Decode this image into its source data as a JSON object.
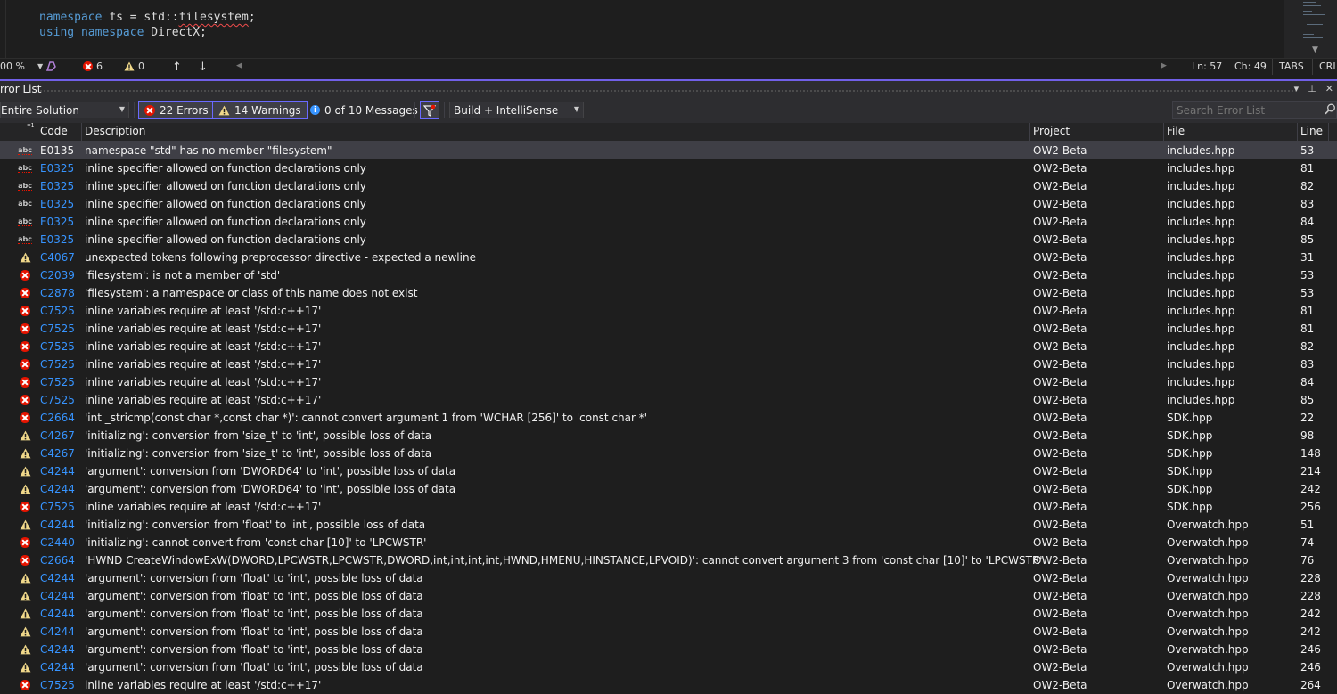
{
  "editor": {
    "line1": {
      "kw": "namespace",
      "mid": " fs = std::",
      "squiggly": "filesystem",
      "end": ";"
    },
    "line2": {
      "kw1": "using",
      "sp": " ",
      "kw2": "namespace",
      "end": " DirectX;"
    }
  },
  "statusbar": {
    "zoom": "00 %",
    "errors": "6",
    "warnings": "0",
    "ln": "Ln: 57",
    "ch": "Ch: 49",
    "tabs": "TABS",
    "eol": "CRL"
  },
  "tool_window": {
    "title": "rror List"
  },
  "toolbar": {
    "scope": "Entire Solution",
    "errors_label": "22 Errors",
    "warnings_label": "14 Warnings",
    "messages_label": "0 of 10 Messages",
    "build_filter": "Build + IntelliSense",
    "search_placeholder": "Search Error List"
  },
  "columns": {
    "code": "Code",
    "description": "Description",
    "project": "Project",
    "file": "File",
    "line": "Line"
  },
  "colors": {
    "accent": "#7160e8",
    "error": "#e51400",
    "warning": "#f0d88a",
    "info": "#3794ff",
    "code_link": "#3794ff"
  },
  "rows": [
    {
      "icon": "intellisense",
      "code": "E0135",
      "desc": "namespace \"std\" has no member \"filesystem\"",
      "project": "OW2-Beta",
      "file": "includes.hpp",
      "line": "53"
    },
    {
      "icon": "intellisense",
      "code": "E0325",
      "desc": "inline specifier allowed on function declarations only",
      "project": "OW2-Beta",
      "file": "includes.hpp",
      "line": "81"
    },
    {
      "icon": "intellisense",
      "code": "E0325",
      "desc": "inline specifier allowed on function declarations only",
      "project": "OW2-Beta",
      "file": "includes.hpp",
      "line": "82"
    },
    {
      "icon": "intellisense",
      "code": "E0325",
      "desc": "inline specifier allowed on function declarations only",
      "project": "OW2-Beta",
      "file": "includes.hpp",
      "line": "83"
    },
    {
      "icon": "intellisense",
      "code": "E0325",
      "desc": "inline specifier allowed on function declarations only",
      "project": "OW2-Beta",
      "file": "includes.hpp",
      "line": "84"
    },
    {
      "icon": "intellisense",
      "code": "E0325",
      "desc": "inline specifier allowed on function declarations only",
      "project": "OW2-Beta",
      "file": "includes.hpp",
      "line": "85"
    },
    {
      "icon": "warning",
      "code": "C4067",
      "desc": "unexpected tokens following preprocessor directive - expected a newline",
      "project": "OW2-Beta",
      "file": "includes.hpp",
      "line": "31"
    },
    {
      "icon": "error",
      "code": "C2039",
      "desc": "'filesystem': is not a member of 'std'",
      "project": "OW2-Beta",
      "file": "includes.hpp",
      "line": "53"
    },
    {
      "icon": "error",
      "code": "C2878",
      "desc": "'filesystem': a namespace or class of this name does not exist",
      "project": "OW2-Beta",
      "file": "includes.hpp",
      "line": "53"
    },
    {
      "icon": "error",
      "code": "C7525",
      "desc": "inline variables require at least '/std:c++17'",
      "project": "OW2-Beta",
      "file": "includes.hpp",
      "line": "81"
    },
    {
      "icon": "error",
      "code": "C7525",
      "desc": "inline variables require at least '/std:c++17'",
      "project": "OW2-Beta",
      "file": "includes.hpp",
      "line": "81"
    },
    {
      "icon": "error",
      "code": "C7525",
      "desc": "inline variables require at least '/std:c++17'",
      "project": "OW2-Beta",
      "file": "includes.hpp",
      "line": "82"
    },
    {
      "icon": "error",
      "code": "C7525",
      "desc": "inline variables require at least '/std:c++17'",
      "project": "OW2-Beta",
      "file": "includes.hpp",
      "line": "83"
    },
    {
      "icon": "error",
      "code": "C7525",
      "desc": "inline variables require at least '/std:c++17'",
      "project": "OW2-Beta",
      "file": "includes.hpp",
      "line": "84"
    },
    {
      "icon": "error",
      "code": "C7525",
      "desc": "inline variables require at least '/std:c++17'",
      "project": "OW2-Beta",
      "file": "includes.hpp",
      "line": "85"
    },
    {
      "icon": "error",
      "code": "C2664",
      "desc": "'int _stricmp(const char *,const char *)': cannot convert argument 1 from 'WCHAR [256]' to 'const char *'",
      "project": "OW2-Beta",
      "file": "SDK.hpp",
      "line": "22"
    },
    {
      "icon": "warning",
      "code": "C4267",
      "desc": "'initializing': conversion from 'size_t' to 'int', possible loss of data",
      "project": "OW2-Beta",
      "file": "SDK.hpp",
      "line": "98"
    },
    {
      "icon": "warning",
      "code": "C4267",
      "desc": "'initializing': conversion from 'size_t' to 'int', possible loss of data",
      "project": "OW2-Beta",
      "file": "SDK.hpp",
      "line": "148"
    },
    {
      "icon": "warning",
      "code": "C4244",
      "desc": "'argument': conversion from 'DWORD64' to 'int', possible loss of data",
      "project": "OW2-Beta",
      "file": "SDK.hpp",
      "line": "214"
    },
    {
      "icon": "warning",
      "code": "C4244",
      "desc": "'argument': conversion from 'DWORD64' to 'int', possible loss of data",
      "project": "OW2-Beta",
      "file": "SDK.hpp",
      "line": "242"
    },
    {
      "icon": "error",
      "code": "C7525",
      "desc": "inline variables require at least '/std:c++17'",
      "project": "OW2-Beta",
      "file": "SDK.hpp",
      "line": "256"
    },
    {
      "icon": "warning",
      "code": "C4244",
      "desc": "'initializing': conversion from 'float' to 'int', possible loss of data",
      "project": "OW2-Beta",
      "file": "Overwatch.hpp",
      "line": "51"
    },
    {
      "icon": "error",
      "code": "C2440",
      "desc": "'initializing': cannot convert from 'const char [10]' to 'LPCWSTR'",
      "project": "OW2-Beta",
      "file": "Overwatch.hpp",
      "line": "74"
    },
    {
      "icon": "error",
      "code": "C2664",
      "desc": "'HWND CreateWindowExW(DWORD,LPCWSTR,LPCWSTR,DWORD,int,int,int,int,HWND,HMENU,HINSTANCE,LPVOID)': cannot convert argument 3 from 'const char [10]' to 'LPCWSTR'",
      "project": "OW2-Beta",
      "file": "Overwatch.hpp",
      "line": "76"
    },
    {
      "icon": "warning",
      "code": "C4244",
      "desc": "'argument': conversion from 'float' to 'int', possible loss of data",
      "project": "OW2-Beta",
      "file": "Overwatch.hpp",
      "line": "228"
    },
    {
      "icon": "warning",
      "code": "C4244",
      "desc": "'argument': conversion from 'float' to 'int', possible loss of data",
      "project": "OW2-Beta",
      "file": "Overwatch.hpp",
      "line": "228"
    },
    {
      "icon": "warning",
      "code": "C4244",
      "desc": "'argument': conversion from 'float' to 'int', possible loss of data",
      "project": "OW2-Beta",
      "file": "Overwatch.hpp",
      "line": "242"
    },
    {
      "icon": "warning",
      "code": "C4244",
      "desc": "'argument': conversion from 'float' to 'int', possible loss of data",
      "project": "OW2-Beta",
      "file": "Overwatch.hpp",
      "line": "242"
    },
    {
      "icon": "warning",
      "code": "C4244",
      "desc": "'argument': conversion from 'float' to 'int', possible loss of data",
      "project": "OW2-Beta",
      "file": "Overwatch.hpp",
      "line": "246"
    },
    {
      "icon": "warning",
      "code": "C4244",
      "desc": "'argument': conversion from 'float' to 'int', possible loss of data",
      "project": "OW2-Beta",
      "file": "Overwatch.hpp",
      "line": "246"
    },
    {
      "icon": "error",
      "code": "C7525",
      "desc": "inline variables require at least '/std:c++17'",
      "project": "OW2-Beta",
      "file": "Overwatch.hpp",
      "line": "264"
    }
  ]
}
